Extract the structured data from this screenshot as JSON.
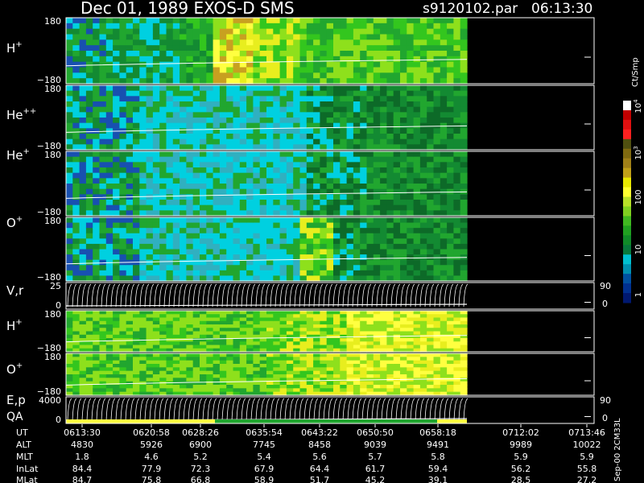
{
  "header": {
    "title": "Dec 01, 1989   EXOS-D SMS",
    "file": "s9120102.par",
    "time": "06:13:30"
  },
  "chart_data": {
    "type": "heatmap",
    "panels": [
      {
        "id": "hp",
        "label": "H",
        "sup": "+",
        "ymax": "180",
        "ymin": "−180",
        "kind": "spec"
      },
      {
        "id": "hepp",
        "label": "He",
        "sup": "++",
        "ymax": "180",
        "ymin": "−180",
        "kind": "spec"
      },
      {
        "id": "hep",
        "label": "He",
        "sup": "+",
        "ymax": "180",
        "ymin": "−180",
        "kind": "spec"
      },
      {
        "id": "op",
        "label": "O",
        "sup": "+",
        "ymax": "180",
        "ymin": "−180",
        "kind": "spec"
      },
      {
        "id": "vr",
        "label": "V,r",
        "sup": "",
        "ymax": "25",
        "ymin": "0",
        "rmax": "90",
        "rmin": "0",
        "kind": "line"
      },
      {
        "id": "hp2",
        "label": "H",
        "sup": "+",
        "ymax": "180",
        "ymin": "−180",
        "kind": "spec2"
      },
      {
        "id": "op2",
        "label": "O",
        "sup": "+",
        "ymax": "180",
        "ymin": "−180",
        "kind": "spec2"
      },
      {
        "id": "ep",
        "label": "E,p",
        "sup": "",
        "label2": "QA",
        "ymax": "4000",
        "ymin": "0",
        "rmax": "90",
        "rmin": "0",
        "kind": "line"
      }
    ],
    "colorbar": {
      "unit": "Ct/Smp",
      "ticks": [
        {
          "base": "10",
          "exp": "4"
        },
        {
          "base": "10",
          "exp": "3"
        },
        {
          "base": "100",
          "exp": ""
        },
        {
          "base": "10",
          "exp": ""
        },
        {
          "base": "1",
          "exp": ""
        }
      ]
    },
    "side_note": "Sep-00  2CM33L",
    "table": {
      "row_labels": [
        "UT",
        "ALT",
        "MLT",
        "InLat",
        "MLat"
      ],
      "columns": [
        [
          "0613:30",
          "4830",
          "1.8",
          "84.4",
          "84.7"
        ],
        [
          "0620:58",
          "5926",
          "4.6",
          "77.9",
          "75.8"
        ],
        [
          "0628:26",
          "6900",
          "5.2",
          "72.3",
          "66.8"
        ],
        [
          "0635:54",
          "7745",
          "5.4",
          "67.9",
          "58.9"
        ],
        [
          "0643:22",
          "8458",
          "5.6",
          "64.4",
          "51.7"
        ],
        [
          "0650:50",
          "9039",
          "5.7",
          "61.7",
          "45.2"
        ],
        [
          "0658:18",
          "9491",
          "5.8",
          "59.4",
          "39.1"
        ],
        [
          "0712:02",
          "9989",
          "5.9",
          "56.2",
          "28.5"
        ],
        [
          "0713:46",
          "10022",
          "5.9",
          "55.8",
          "27.2"
        ]
      ]
    }
  }
}
